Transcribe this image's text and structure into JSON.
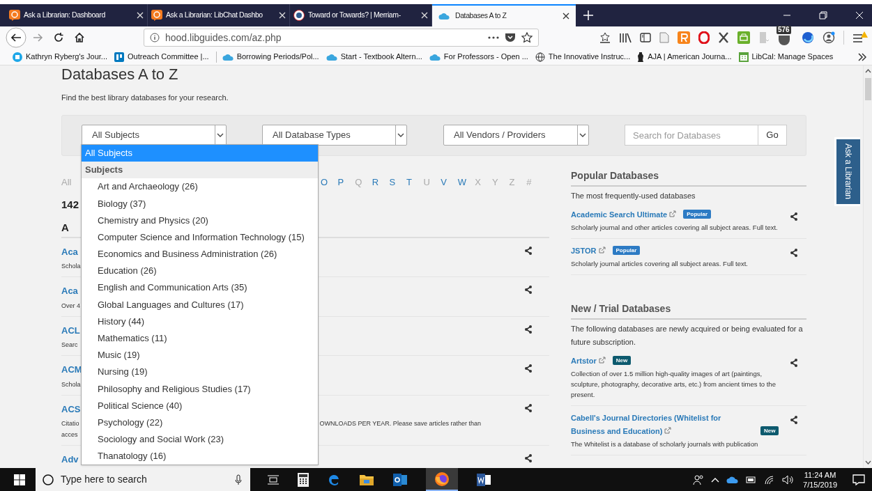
{
  "browser": {
    "tabs": [
      {
        "title": "Ask a Librarian: Dashboard",
        "kind": "chat",
        "selected": false
      },
      {
        "title": "Ask a Librarian: LibChat Dashbo",
        "kind": "chat",
        "selected": false
      },
      {
        "title": "Toward or Towards? | Merriam-",
        "kind": "mw",
        "selected": false
      },
      {
        "title": "Databases A to Z",
        "kind": "cloud",
        "selected": true
      }
    ],
    "url": "hood.libguides.com/az.php",
    "extension_badge": "576",
    "bookmarks": [
      {
        "label": "Kathryn Ryberg's Jour...",
        "kind": "site"
      },
      {
        "label": "Outreach Committee |...",
        "kind": "board"
      },
      {
        "label": "Borrowing Periods/Pol...",
        "kind": "cloud"
      },
      {
        "label": "Start - Textbook Altern...",
        "kind": "cloud"
      },
      {
        "label": "For Professors - Open ...",
        "kind": "cloud"
      },
      {
        "label": "The Innovative Instruc...",
        "kind": "globe"
      },
      {
        "label": "AJA | American Journa...",
        "kind": "vase"
      },
      {
        "label": "LibCal: Manage Spaces",
        "kind": "calendar"
      }
    ]
  },
  "page": {
    "title": "Databases A to Z",
    "subtitle": "Find the best library databases for your research.",
    "filters": [
      {
        "kind": "select",
        "value": "All Subjects"
      },
      {
        "kind": "select",
        "value": "All Database Types"
      },
      {
        "kind": "select",
        "value": "All Vendors / Providers"
      },
      {
        "kind": "search",
        "placeholder": "Search for Databases"
      }
    ],
    "go_button": "Go",
    "subject_dropdown": {
      "options": [
        {
          "label": "All Subjects",
          "selected": true
        }
      ],
      "group": "Subjects",
      "items": [
        {
          "label": "Art and Archaeology (26)",
          "selected": false
        },
        {
          "label": "Biology (37)",
          "selected": false
        },
        {
          "label": "Chemistry and Physics (20)",
          "selected": false
        },
        {
          "label": "Computer Science and Information Technology (15)",
          "selected": false
        },
        {
          "label": "Economics and Business Administration (26)",
          "selected": false
        },
        {
          "label": "Education (26)",
          "selected": false
        },
        {
          "label": "English and Communication Arts (35)",
          "selected": false
        },
        {
          "label": "Global Languages and Cultures (17)",
          "selected": false
        },
        {
          "label": "History (44)",
          "selected": false
        },
        {
          "label": "Mathematics (11)",
          "selected": false
        },
        {
          "label": "Music (19)",
          "selected": false
        },
        {
          "label": "Nursing (19)",
          "selected": false
        },
        {
          "label": "Philosophy and Religious Studies (17)",
          "selected": false
        },
        {
          "label": "Political Science (40)",
          "selected": false
        },
        {
          "label": "Psychology (22)",
          "selected": false
        },
        {
          "label": "Sociology and Social Work (23)",
          "selected": false
        },
        {
          "label": "Thanatology (16)",
          "selected": false
        }
      ]
    },
    "letters_before": [
      {
        "label": "All",
        "enabled": false
      }
    ],
    "letters": [
      {
        "label": "O",
        "enabled": true
      },
      {
        "label": "P",
        "enabled": true
      },
      {
        "label": "Q",
        "enabled": false
      },
      {
        "label": "R",
        "enabled": true
      },
      {
        "label": "S",
        "enabled": true
      },
      {
        "label": "T",
        "enabled": true
      },
      {
        "label": "U",
        "enabled": false
      },
      {
        "label": "V",
        "enabled": true
      },
      {
        "label": "W",
        "enabled": true
      },
      {
        "label": "X",
        "enabled": false
      },
      {
        "label": "Y",
        "enabled": false
      },
      {
        "label": "Z",
        "enabled": false
      },
      {
        "label": "#",
        "enabled": false
      }
    ],
    "count": "142",
    "section": "A",
    "rows": [
      {
        "title": "Aca",
        "lines": [
          "Schola"
        ]
      },
      {
        "title": "Aca",
        "lines": [
          "Over 4"
        ]
      },
      {
        "title": "ACL",
        "lines": [
          "Searc"
        ]
      },
      {
        "title": "ACM",
        "lines": [
          "Schola"
        ]
      },
      {
        "title": "ACS",
        "lines": [
          "Citatio",
          "acces"
        ],
        "tail": "OWNLOADS PER YEAR. Please save articles rather than"
      },
      {
        "title": "Adv",
        "lines": []
      }
    ],
    "popular": {
      "heading": "Popular Databases",
      "intro": "The most frequently-used databases",
      "items": [
        {
          "title": "Academic Search Ultimate",
          "badge": "Popular",
          "kind": "popular",
          "description": "Scholarly journal and other articles covering all subject areas. Full text."
        },
        {
          "title": "JSTOR",
          "badge": "Popular",
          "kind": "popular",
          "description": "Scholarly journal articles covering all subject areas. Full text."
        }
      ]
    },
    "new_trial": {
      "heading": "New / Trial Databases",
      "intro": "The following databases are newly acquired or being evaluated for a future subscription.",
      "items": [
        {
          "title": "Artstor",
          "badge": "New",
          "kind": "new",
          "description": "Collection of over 1.5 million high-quality images of art (paintings, sculpture, photography, decorative arts, etc.) from ancient times to the present."
        },
        {
          "title": "Cabell's Journal Directories (Whitelist for Business and Education)",
          "badge": "New",
          "kind": "new",
          "description": "The Whitelist is a database of scholarly journals with publication"
        }
      ]
    },
    "side_tab": "Ask a Librarian"
  },
  "taskbar": {
    "search_placeholder": "Type here to search",
    "time": "11:24 AM",
    "date": "7/15/2019"
  }
}
